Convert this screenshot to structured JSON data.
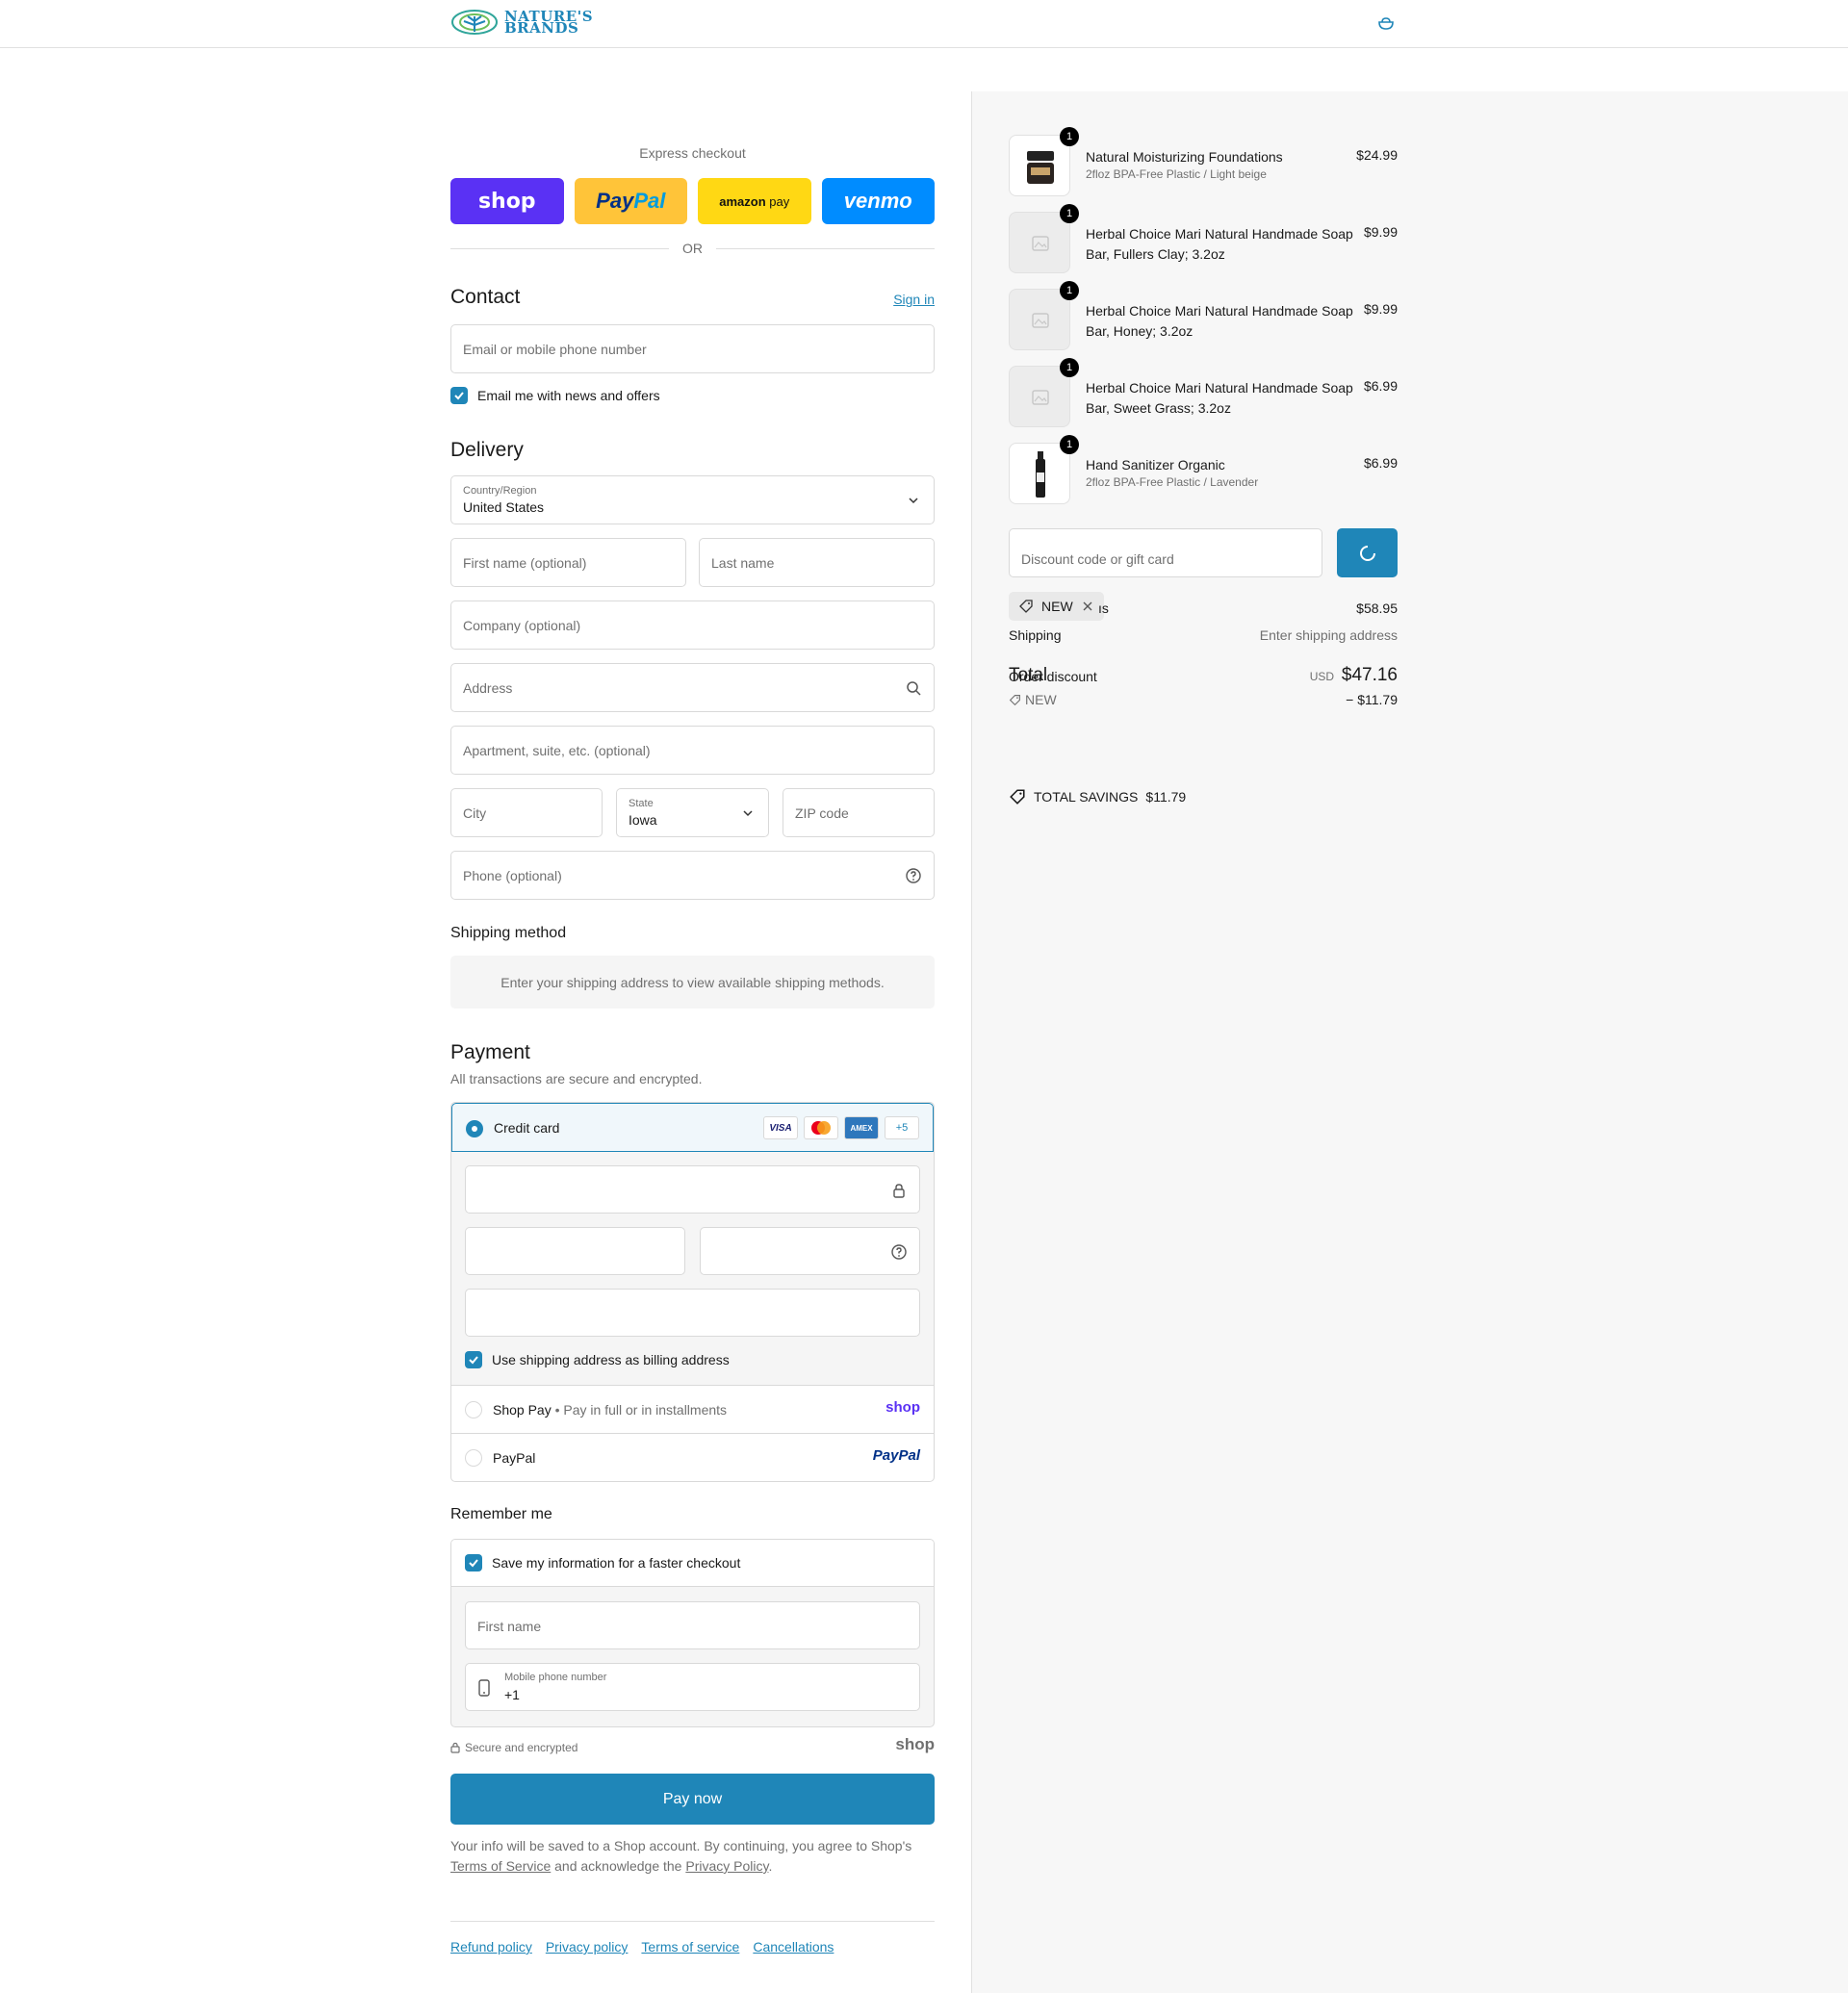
{
  "brand": {
    "line1": "NATURE'S",
    "line2": "BRANDS"
  },
  "express": {
    "title": "Express checkout",
    "shop_label": "shop",
    "paypal_a": "Pay",
    "paypal_b": "Pal",
    "amazon_a": "amazon",
    "amazon_b": "pay",
    "venmo_label": "venmo",
    "or_label": "OR"
  },
  "contact": {
    "title": "Contact",
    "sign_in": "Sign in",
    "email_placeholder": "Email or mobile phone number",
    "news_label": "Email me with news and offers",
    "news_checked": true
  },
  "delivery": {
    "title": "Delivery",
    "country_label": "Country/Region",
    "country_value": "United States",
    "first_name": "First name (optional)",
    "last_name": "Last name",
    "company": "Company (optional)",
    "address": "Address",
    "apartment": "Apartment, suite, etc. (optional)",
    "city": "City",
    "state_label": "State",
    "state_value": "Iowa",
    "zip": "ZIP code",
    "phone": "Phone (optional)"
  },
  "shipping_method": {
    "title": "Shipping method",
    "info": "Enter your shipping address to view available shipping methods."
  },
  "payment": {
    "title": "Payment",
    "subtitle": "All transactions are secure and encrypted.",
    "credit_card_label": "Credit card",
    "card_brands": [
      "VISA",
      "MC",
      "AMEX"
    ],
    "more_cards": "+5",
    "billing_label": "Use shipping address as billing address",
    "billing_checked": true,
    "shop_pay_label": "Shop Pay",
    "shop_pay_sub": "Pay in full or in installments",
    "shop_pay_brand": "shop",
    "paypal_label": "PayPal",
    "paypal_brand": "PayPal"
  },
  "remember": {
    "title": "Remember me",
    "save_label": "Save my information for a faster checkout",
    "save_checked": true,
    "first_name": "First name",
    "mobile_label": "Mobile phone number",
    "mobile_value": "+1"
  },
  "secure_label": "Secure and encrypted",
  "shop_mark": "shop",
  "pay_now": "Pay now",
  "legal": {
    "text1": "Your info will be saved to a Shop account. By continuing, you agree to Shop's",
    "tos": "Terms of Service",
    "text2": "and acknowledge the",
    "privacy": "Privacy Policy",
    "text3": "."
  },
  "footer": [
    "Refund policy",
    "Privacy policy",
    "Terms of service",
    "Cancellations"
  ],
  "cart": {
    "items": [
      {
        "name": "Natural Moisturizing Foundations",
        "variant": "2floz BPA-Free Plastic / Light beige",
        "price": "$24.99",
        "qty": "1",
        "thumb": "jar"
      },
      {
        "name": "Herbal Choice Mari Natural Handmade Soap Bar, Fullers Clay; 3.2oz",
        "variant": "",
        "price": "$9.99",
        "qty": "1",
        "thumb": "placeholder"
      },
      {
        "name": "Herbal Choice Mari Natural Handmade Soap Bar, Honey; 3.2oz",
        "variant": "",
        "price": "$9.99",
        "qty": "1",
        "thumb": "placeholder"
      },
      {
        "name": "Herbal Choice Mari Natural Handmade Soap Bar, Sweet Grass; 3.2oz",
        "variant": "",
        "price": "$6.99",
        "qty": "1",
        "thumb": "placeholder"
      },
      {
        "name": "Hand Sanitizer Organic",
        "variant": "2floz BPA-Free Plastic / Lavender",
        "price": "$6.99",
        "qty": "1",
        "thumb": "bottle"
      }
    ],
    "discount_placeholder": "Discount code or gift card",
    "applied_code": "NEW",
    "subtotal_label_fragment": "ıs",
    "subtotal": "$58.95",
    "shipping_label": "Shipping",
    "shipping_value": "Enter shipping address",
    "total_label": "Total",
    "order_discount_label": "Order discount",
    "currency": "USD",
    "total": "$47.16",
    "discount_code": "NEW",
    "discount_amount": "− $11.79",
    "savings_label": "TOTAL SAVINGS",
    "savings_amount": "$11.79"
  },
  "colors": {
    "accent": "#1f86b8",
    "shop": "#5a31f4",
    "paypal": "#ffc439",
    "amazon": "#ffd814",
    "venmo": "#008cff"
  }
}
